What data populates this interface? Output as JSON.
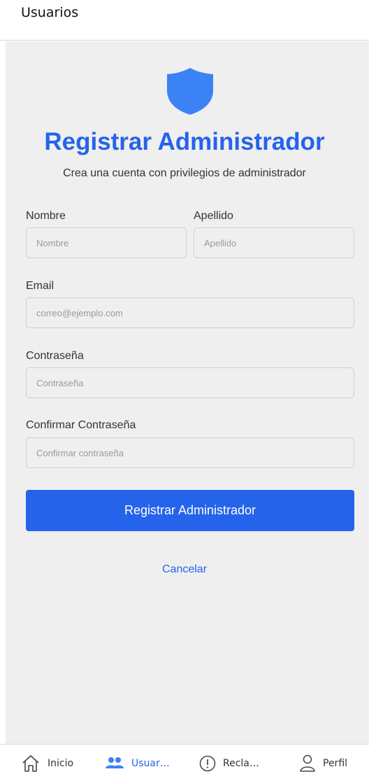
{
  "header": {
    "title": "Usuarios"
  },
  "form": {
    "title": "Registrar Administrador",
    "subtitle": "Crea una cuenta con privilegios de administrador",
    "first_name": {
      "label": "Nombre",
      "placeholder": "Nombre"
    },
    "last_name": {
      "label": "Apellido",
      "placeholder": "Apellido"
    },
    "email": {
      "label": "Email",
      "placeholder": "correo@ejemplo.com"
    },
    "password": {
      "label": "Contraseña",
      "placeholder": "Contraseña"
    },
    "confirm_password": {
      "label": "Confirmar Contraseña",
      "placeholder": "Confirmar contraseña"
    },
    "submit_label": "Registrar Administrador",
    "cancel_label": "Cancelar"
  },
  "tabs": [
    {
      "label": "Inicio",
      "icon": "home-icon",
      "active": false
    },
    {
      "label": "Usuar…",
      "icon": "users-icon",
      "active": true
    },
    {
      "label": "Recla…",
      "icon": "alert-circle-icon",
      "active": false
    },
    {
      "label": "Perfil",
      "icon": "person-icon",
      "active": false
    }
  ],
  "colors": {
    "accent": "#2563eb",
    "background": "#efefef"
  }
}
